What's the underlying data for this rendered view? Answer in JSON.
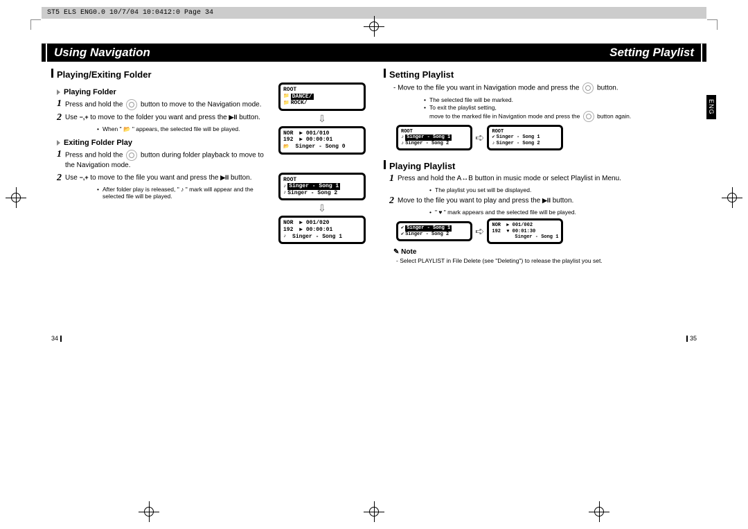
{
  "doc_header": "ST5 ELS ENG0.0  10/7/04 10:0412:0  Page 34",
  "left": {
    "title": "Using Navigation",
    "section": "Playing/Exiting Folder",
    "sub1": "Playing Folder",
    "s1_step1_a": "Press and hold the",
    "s1_step1_b": "button to move to the Navigation mode.",
    "s1_step2_a": "Use",
    "s1_step2_b": "to move to the folder you want and press the",
    "s1_step2_c": "button.",
    "s1_bullet": "When \" 📂 \" appears, the selected file will be played.",
    "sub2": "Exiting Folder Play",
    "s2_step1_a": "Press and hold the",
    "s2_step1_b": "button during folder playback to move to the Navigation mode.",
    "s2_step2_a": "Use",
    "s2_step2_b": "to move to the file you want and press the",
    "s2_step2_c": "button.",
    "s2_bullet": "After folder play is released, \" ♪ \" mark will appear and the selected file will be played.",
    "ctrl_minus_plus": "−,+",
    "ctrl_play": "▶II",
    "pgnum": "34"
  },
  "right": {
    "title": "Setting Playlist",
    "section1": "Setting Playlist",
    "r1_line_a": "- Move to the file you want in Navigation mode and press the",
    "r1_line_b": "button.",
    "r1_b1": "The selected file will be marked.",
    "r1_b2a": "To exit the playlist setting,",
    "r1_b2b": "move to the marked file in Navigation mode and press the",
    "r1_b2c": "button again.",
    "section2": "Playing Playlist",
    "r2_step1_a": "Press and hold the A↔B button in music mode or select Playlist in Menu.",
    "r2_b1": "The playlist you set will be displayed.",
    "r2_step2_a": "Move to the file you want to play and press the",
    "r2_step2_b": "button.",
    "r2_b2": "\" ♥ \" mark appears and the selected file will be played.",
    "note_label": "✎ Note",
    "note_text": "- Select PLAYLIST in File Delete (see \"Deleting\") to release the playlist you set.",
    "pgnum": "35",
    "eng": "ENG"
  },
  "lcd": {
    "root": "ROOT",
    "dance": "DANCE/",
    "rock": "ROCK/",
    "nor": "NOR",
    "k192": "192",
    "track_a": "▶ 001/010",
    "time_a": "▶ 00:00:01",
    "song0": "Singer - Song 0",
    "song1": "Singer - Song 1",
    "song2": "Singer - Song 2",
    "track_b": "▶ 001/020",
    "time_b": "▶ 00:00:01",
    "track_c": "▶ 001/002",
    "time_c": "♥ 00:01:30"
  }
}
